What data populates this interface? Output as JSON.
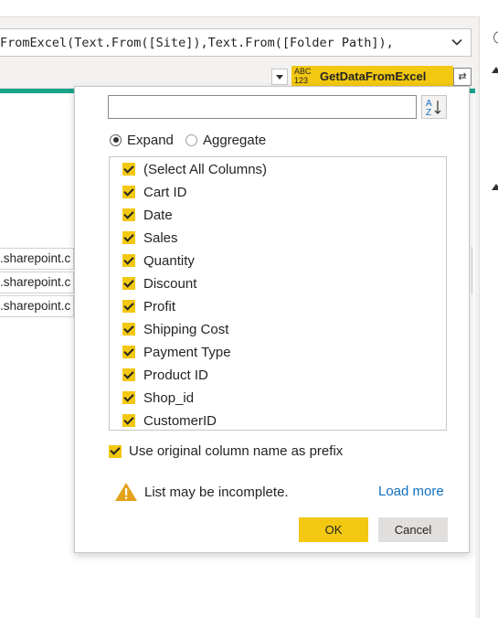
{
  "formula_bar": {
    "text": "FromExcel(Text.From([Site]),Text.From([Folder Path]),"
  },
  "column_header": {
    "type_icon_top": "ABC",
    "type_icon_bottom": "123",
    "name": "GetDataFromExcel",
    "expand_icon": "expand-columns-icon"
  },
  "grid_cells": [
    ".sharepoint.c",
    ".sharepoint.c",
    ".sharepoint.c"
  ],
  "expand_popup": {
    "search_placeholder": "",
    "sort_icon": "sort-az-icon",
    "mode_options": [
      {
        "label": "Expand",
        "selected": true
      },
      {
        "label": "Aggregate",
        "selected": false
      }
    ],
    "columns": [
      {
        "label": "(Select All Columns)",
        "checked": true
      },
      {
        "label": "Cart ID",
        "checked": true
      },
      {
        "label": "Date",
        "checked": true
      },
      {
        "label": "Sales",
        "checked": true
      },
      {
        "label": "Quantity",
        "checked": true
      },
      {
        "label": "Discount",
        "checked": true
      },
      {
        "label": "Profit",
        "checked": true
      },
      {
        "label": "Shipping Cost",
        "checked": true
      },
      {
        "label": "Payment Type",
        "checked": true
      },
      {
        "label": "Product ID",
        "checked": true
      },
      {
        "label": "Shop_id",
        "checked": true
      },
      {
        "label": "CustomerID",
        "checked": true
      }
    ],
    "prefix_label": "Use original column name as prefix",
    "prefix_checked": true,
    "warning_text": "List may be incomplete.",
    "load_more": "Load more",
    "ok": "OK",
    "cancel": "Cancel"
  },
  "colors": {
    "accent": "#f2c811",
    "teal": "#1aa48c",
    "link": "#106ebe",
    "warning": "#e3a21a"
  }
}
